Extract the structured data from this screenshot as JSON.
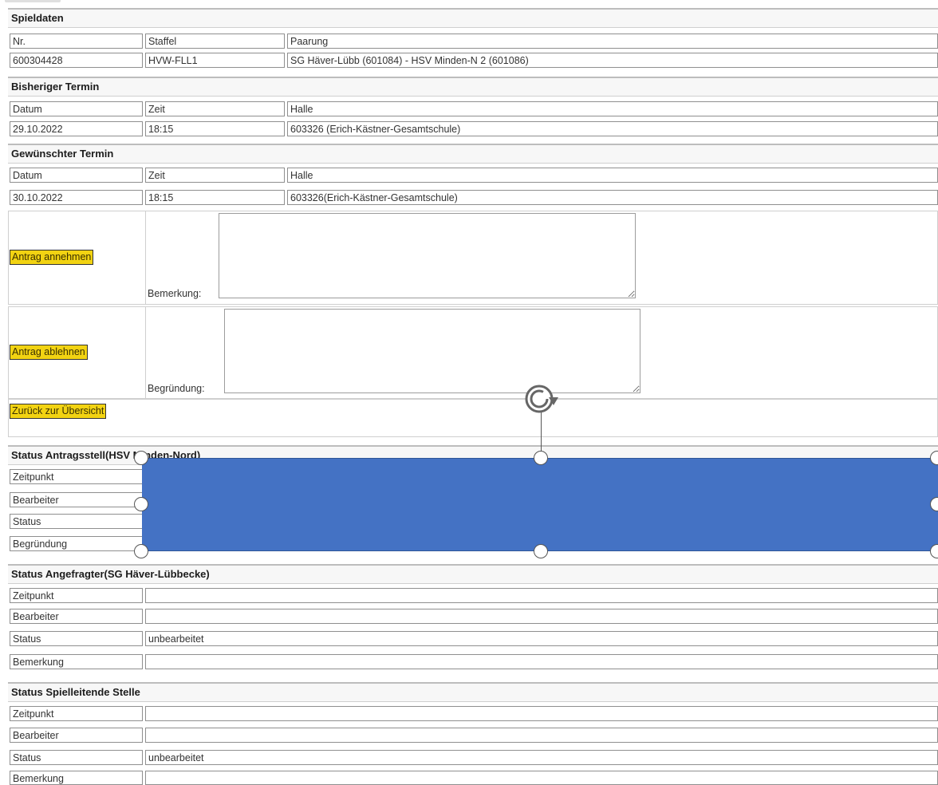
{
  "spieldaten": {
    "heading": "Spieldaten",
    "col_nr": "Nr.",
    "col_staffel": "Staffel",
    "col_paarung": "Paarung",
    "nr": "600304428",
    "staffel": "HVW-FLL1",
    "paarung": "SG Häver-Lübb (601084) - HSV Minden-N 2 (601086)"
  },
  "bisheriger_termin": {
    "heading": "Bisheriger Termin",
    "col_datum": "Datum",
    "col_zeit": "Zeit",
    "col_halle": "Halle",
    "datum": "29.10.2022",
    "zeit": "18:15",
    "halle": "603326 (Erich-Kästner-Gesamtschule)"
  },
  "gewuenschter_termin": {
    "heading": "Gewünschter Termin",
    "col_datum": "Datum",
    "col_zeit": "Zeit",
    "col_halle": "Halle",
    "datum": "30.10.2022",
    "zeit": "18:15",
    "halle": "603326(Erich-Kästner-Gesamtschule)"
  },
  "actions": {
    "annehmen_label": "Antrag annehmen",
    "bemerkung_label": "Bemerkung:",
    "ablehnen_label": "Antrag ablehnen",
    "begruendung_label": "Begründung:",
    "zurueck_label": "Zurück zur Übersicht"
  },
  "status_antragsteller": {
    "heading": "Status Antragsstell(HSV Minden-Nord)",
    "rows": [
      "Zeitpunkt",
      "Bearbeiter",
      "Status",
      "Begründung"
    ]
  },
  "status_angefragter": {
    "heading": "Status Angefragter(SG Häver-Lübbecke)",
    "rows": [
      {
        "label": "Zeitpunkt",
        "value": ""
      },
      {
        "label": "Bearbeiter",
        "value": ""
      },
      {
        "label": "Status",
        "value": "unbearbeitet"
      },
      {
        "label": "Bemerkung",
        "value": ""
      }
    ]
  },
  "status_spielleitende": {
    "heading": "Status Spielleitende Stelle",
    "rows": [
      {
        "label": "Zeitpunkt",
        "value": ""
      },
      {
        "label": "Bearbeiter",
        "value": ""
      },
      {
        "label": "Status",
        "value": "unbearbeitet"
      },
      {
        "label": "Bemerkung",
        "value": ""
      }
    ]
  },
  "overlay": {
    "shape_color": "#4472c4",
    "rotate_icon": "rotate-icon",
    "handle_icon": "resize-handle-icon"
  }
}
